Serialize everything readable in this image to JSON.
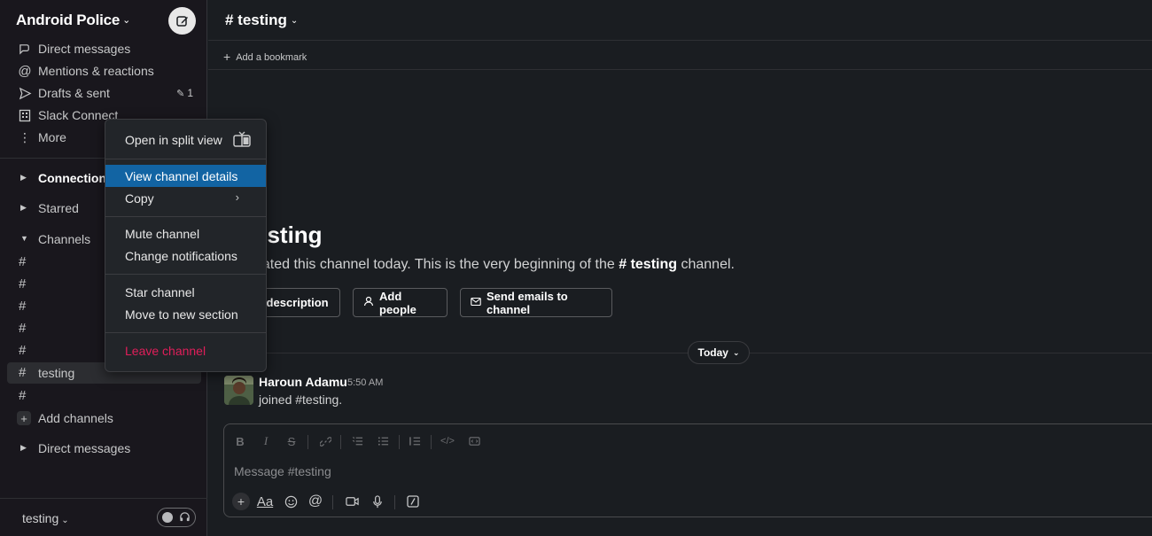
{
  "workspace": {
    "name": "Android Police"
  },
  "nav": {
    "direct_messages": "Direct messages",
    "mentions": "Mentions & reactions",
    "drafts": "Drafts & sent",
    "drafts_count": "1",
    "slack_connect": "Slack Connect",
    "more": "More"
  },
  "sections": {
    "connections": "Connections",
    "starred": "Starred",
    "channels": "Channels",
    "direct_messages": "Direct messages"
  },
  "channels": [
    {
      "name": ""
    },
    {
      "name": ""
    },
    {
      "name": ""
    },
    {
      "name": ""
    },
    {
      "name": ""
    },
    {
      "name": "testing"
    },
    {
      "name": ""
    }
  ],
  "add_channels": "Add channels",
  "footer": {
    "user": "testing"
  },
  "header": {
    "channel": "# testing"
  },
  "bookmark": {
    "add_label": "Add a bookmark"
  },
  "intro": {
    "title": "esting",
    "sub_prefix": "eated this channel today. This is the very beginning of the ",
    "sub_channel": "# testing",
    "sub_suffix": " channel.",
    "btn_description": "d description",
    "btn_add_people": "Add people",
    "btn_send_emails": "Send emails to channel"
  },
  "divider": {
    "label": "Today"
  },
  "message": {
    "author": "Haroun Adamu",
    "time": "5:50 AM",
    "text": "joined #testing."
  },
  "composer": {
    "placeholder": "Message #testing"
  },
  "context_menu": {
    "open_split": "Open in split view",
    "view_details": "View channel details",
    "copy": "Copy",
    "mute": "Mute channel",
    "change_notifications": "Change notifications",
    "star": "Star channel",
    "move_section": "Move to new section",
    "leave": "Leave channel"
  },
  "colors": {
    "selected": "#1264a3",
    "danger": "#e01e5a",
    "sidebar": "#19171d",
    "background": "#1a1d21"
  }
}
